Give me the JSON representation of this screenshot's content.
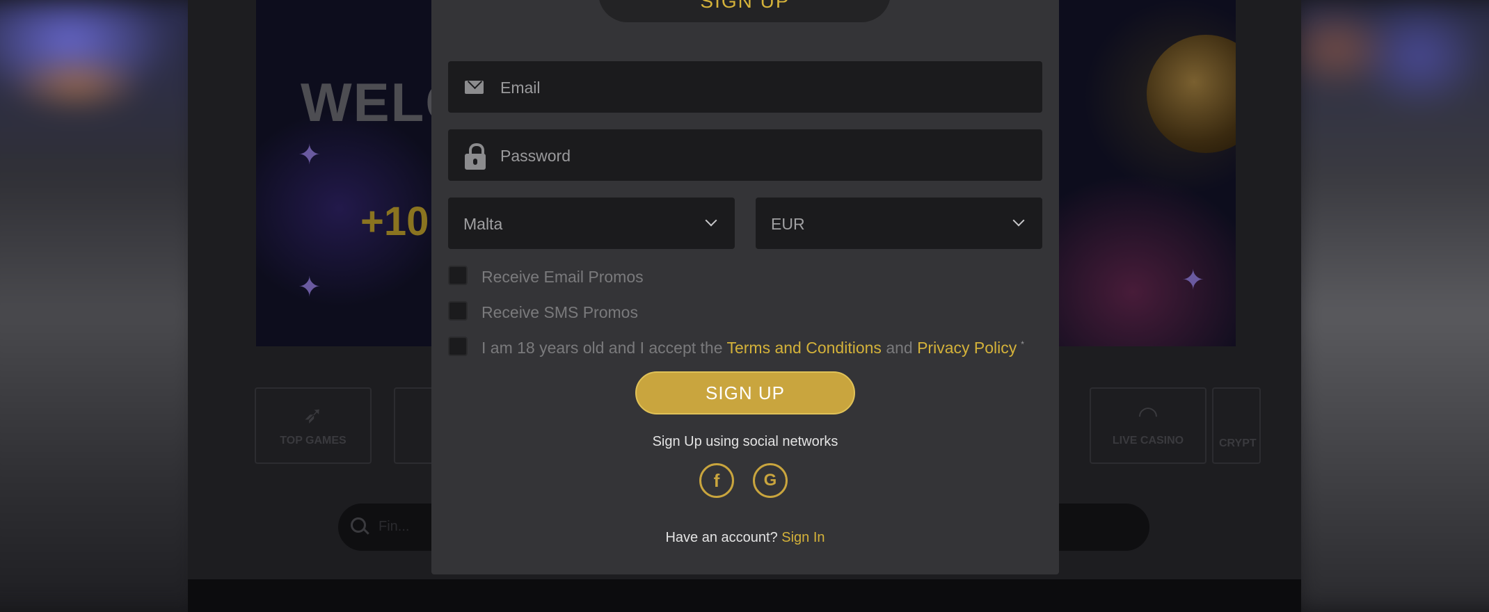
{
  "background": {
    "hero_heading": "WELC",
    "hero_bonus": "+10",
    "categories": [
      {
        "label": "TOP GAMES",
        "icon": "rocket-icon"
      },
      {
        "label": "",
        "icon": ""
      },
      {
        "label": "LIVE CASINO",
        "icon": "lips-icon"
      },
      {
        "label": "CRYPT",
        "icon": ""
      }
    ],
    "search_placeholder": "Fin..."
  },
  "modal": {
    "title": "SIGN UP",
    "email": {
      "placeholder": "Email",
      "value": "",
      "icon": "mail-icon"
    },
    "password": {
      "placeholder": "Password",
      "value": "",
      "icon": "lock-icon"
    },
    "country": {
      "value": "Malta",
      "icon": "chevron-down-icon"
    },
    "currency": {
      "value": "EUR",
      "icon": "chevron-down-icon"
    },
    "checkboxes": {
      "email_promos": "Receive Email Promos",
      "sms_promos": "Receive SMS Promos",
      "terms_prefix": "I am 18 years old and I accept the",
      "terms_link": "Terms and Conditions",
      "terms_and": "and",
      "privacy_link": "Privacy Policy",
      "required_mark": "*"
    },
    "submit_label": "SIGN UP",
    "social_caption": "Sign Up using social networks",
    "social": [
      {
        "label": "f",
        "icon": "facebook-icon"
      },
      {
        "label": "G",
        "icon": "google-icon"
      }
    ],
    "account_prompt": "Have an account?",
    "sign_in_link": "Sign In"
  },
  "colors": {
    "accent": "#c9a53e",
    "modal_bg": "#343437",
    "field_bg": "#1b1b1d"
  }
}
